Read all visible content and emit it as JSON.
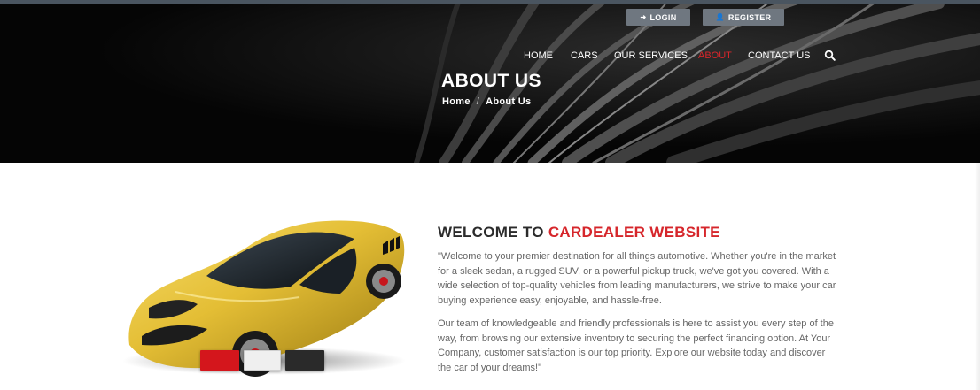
{
  "auth": {
    "login_label": "LOGIN",
    "register_label": "REGISTER"
  },
  "nav": {
    "items": [
      {
        "label": "HOME"
      },
      {
        "label": "CARS"
      },
      {
        "label": "OUR SERVICES"
      },
      {
        "label": "ABOUT"
      },
      {
        "label": "CONTACT US"
      }
    ],
    "search_icon": "search-icon"
  },
  "hero": {
    "title": "ABOUT US",
    "breadcrumb": {
      "home": "Home",
      "separator": "/",
      "current": "About Us"
    }
  },
  "about": {
    "heading_prefix": "WELCOME TO",
    "heading_accent": "CARDEALER WEBSITE",
    "paragraphs": [
      "\"Welcome to your premier destination for all things automotive. Whether you're in the market for a sleek sedan, a rugged SUV, or a powerful pickup truck, we've got you covered. With a wide selection of top-quality vehicles from leading manufacturers, we strive to make your car buying experience easy, enjoyable, and hassle-free.",
      "Our team of knowledgeable and friendly professionals is here to assist you every step of the way, from browsing our extensive inventory to securing the perfect financing option. At Your Company, customer satisfaction is our top priority. Explore our website today and discover the car of your dreams!\""
    ]
  },
  "colors": {
    "accent": "#d6262b",
    "hero_bg": "#050505",
    "button_bg": "#6f7780",
    "text": "#666666"
  }
}
